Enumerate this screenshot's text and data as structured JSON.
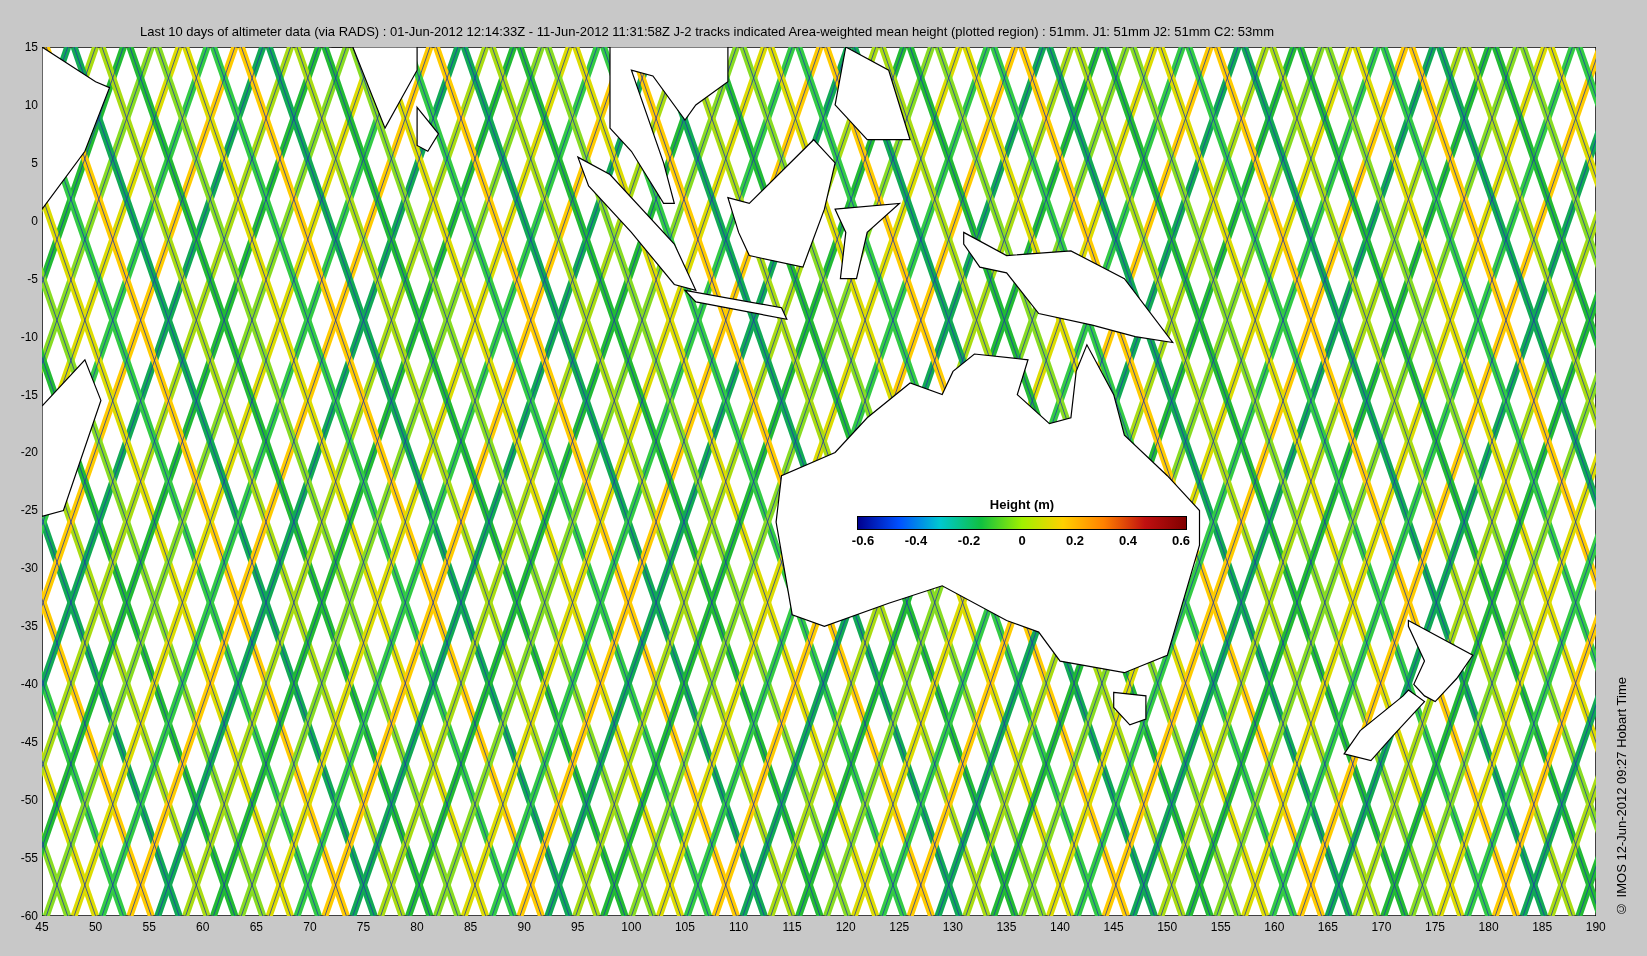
{
  "title": "Last 10 days of altimeter data (via RADS) : 01-Jun-2012 12:14:33Z - 11-Jun-2012 11:31:58Z  J-2 tracks indicated  Area-weighted mean height (plotted region) : 51mm.  J1: 51mm  J2: 51mm  C2: 53mm",
  "y_axis_labels": [
    "15",
    "10",
    "5",
    "0",
    "-5",
    "-10",
    "-15",
    "-20",
    "-25",
    "-30",
    "-35",
    "-40",
    "-45",
    "-50",
    "-55",
    "-60"
  ],
  "x_axis_labels": [
    "45",
    "50",
    "55",
    "60",
    "65",
    "70",
    "75",
    "80",
    "85",
    "90",
    "95",
    "100",
    "105",
    "110",
    "115",
    "120",
    "125",
    "130",
    "135",
    "140",
    "145",
    "150",
    "155",
    "160",
    "165",
    "170",
    "175",
    "180",
    "185",
    "190"
  ],
  "colorbar": {
    "title": "Height (m)",
    "tick_labels": [
      "-0.6",
      "-0.4",
      "-0.2",
      "0",
      "0.2",
      "0.4",
      "0.6"
    ]
  },
  "credit": "© IMOS 12-Jun-2012 09:27 Hobart Time"
}
